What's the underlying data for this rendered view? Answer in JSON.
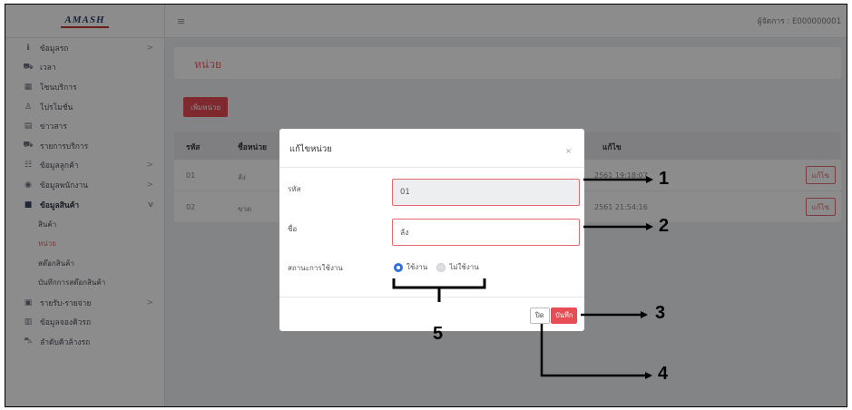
{
  "logo": "AMASH",
  "topbar": {
    "menu_icon": "hamburger-icon",
    "user": "ผู้จัดการ : E000000001"
  },
  "sidebar": {
    "items": [
      {
        "label": "ข้อมูลรถ",
        "icon": "info-icon",
        "chevron": ">"
      },
      {
        "label": "เวลา",
        "icon": "car-icon",
        "chevron": ""
      },
      {
        "label": "โซนบริการ",
        "icon": "grid-icon",
        "chevron": ""
      },
      {
        "label": "โปรโมชั่น",
        "icon": "person-icon",
        "chevron": ""
      },
      {
        "label": "ข่าวสาร",
        "icon": "news-icon",
        "chevron": ""
      },
      {
        "label": "รายการบริการ",
        "icon": "car-icon",
        "chevron": ""
      },
      {
        "label": "ข้อมูลลูกค้า",
        "icon": "users-icon",
        "chevron": ">"
      },
      {
        "label": "ข้อมูลพนักงาน",
        "icon": "user-circle-icon",
        "chevron": ">"
      },
      {
        "label": "ข้อมูลสินค้า",
        "icon": "box-icon",
        "chevron": "v"
      }
    ],
    "sub_items": [
      "สินค้า",
      "หน่วย",
      "สต๊อกสินค้า",
      "บันทึกการสต๊อกสินค้า"
    ],
    "items_after": [
      {
        "label": "รายรับ-รายจ่าย",
        "icon": "money-icon",
        "chevron": ">"
      },
      {
        "label": "ข้อมูลจองคิวรถ",
        "icon": "calendar-icon",
        "chevron": ""
      },
      {
        "label": "ลำดับคิวล้างรถ",
        "icon": "car-wash-icon",
        "chevron": ""
      }
    ]
  },
  "page": {
    "title": "หน่วย",
    "add_button": "เพิ่มหน่วย",
    "table": {
      "headers": [
        "รหัส",
        "ชื่อหน่วย",
        "แก้ไข"
      ],
      "rows": [
        {
          "code": "01",
          "name": "ลัง",
          "date": "2561 19:18:07",
          "edit": "แก้ไข"
        },
        {
          "code": "02",
          "name": "ขวด",
          "date": "2561 21:54:16",
          "edit": "แก้ไข"
        }
      ]
    }
  },
  "modal": {
    "title": "แก้ไขหน่วย",
    "close_icon": "×",
    "code_label": "รหัส",
    "code_value": "01",
    "name_label": "ชื่อ",
    "name_value": "ลัง",
    "status_label": "สถานะการใช้งาน",
    "status_options": [
      "ใช้งาน",
      "ไม่ใช้งาน"
    ],
    "status_selected": "ใช้งาน",
    "close_button": "ปิด",
    "save_button": "บันทึก"
  },
  "annotations": [
    "1",
    "2",
    "3",
    "4",
    "5"
  ],
  "colors": {
    "accent": "#e84c55",
    "radio_selected": "#2d6fe0",
    "annotation": "#000000"
  }
}
